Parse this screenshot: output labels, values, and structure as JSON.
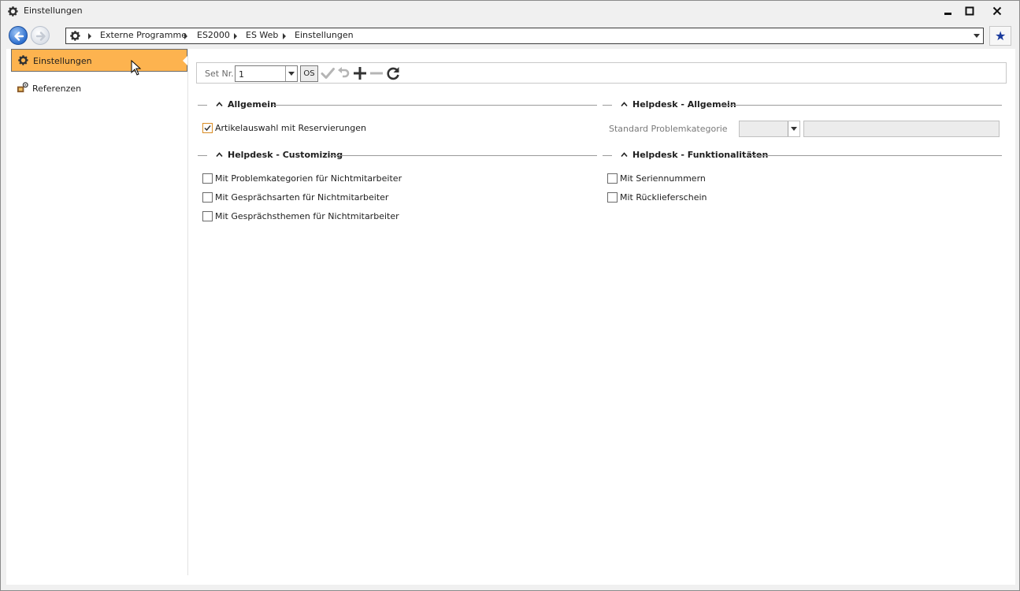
{
  "window": {
    "title": "Einstellungen",
    "app_icon": "gear-icon"
  },
  "breadcrumb": {
    "icon": "gear-icon",
    "items": [
      "Externe Programme",
      "ES2000",
      "ES Web",
      "Einstellungen"
    ]
  },
  "sidebar": {
    "items": [
      {
        "label": "Einstellungen",
        "icon": "gear-icon",
        "active": true
      },
      {
        "label": "Referenzen",
        "icon": "references-icon",
        "active": false
      }
    ]
  },
  "toolbar": {
    "set_label": "Set Nr.",
    "set_value": "1",
    "os_label": "OS",
    "icons": [
      "check-icon",
      "undo-icon",
      "plus-icon",
      "minus-icon",
      "refresh-icon"
    ]
  },
  "sections": {
    "allgemein": {
      "title": "Allgemein",
      "items": [
        {
          "label": "Artikelauswahl mit Reservierungen",
          "checked": true
        }
      ]
    },
    "helpdesk_allgemein": {
      "title": "Helpdesk - Allgemein",
      "field_label": "Standard Problemkategorie"
    },
    "helpdesk_customizing": {
      "title": "Helpdesk - Customizing",
      "items": [
        {
          "label": "Mit Problemkategorien für Nichtmitarbeiter",
          "checked": false
        },
        {
          "label": "Mit Gesprächsarten für Nichtmitarbeiter",
          "checked": false
        },
        {
          "label": "Mit Gesprächsthemen für Nichtmitarbeiter",
          "checked": false
        }
      ]
    },
    "helpdesk_funktionalitaeten": {
      "title": "Helpdesk - Funktionalitäten",
      "items": [
        {
          "label": "Mit Seriennummern",
          "checked": false
        },
        {
          "label": "Mit Rücklieferschein",
          "checked": false
        }
      ]
    }
  },
  "colors": {
    "active_item": "#fdb34f",
    "accent_check": "#d98c24",
    "favorite_star": "#1a3a9c"
  }
}
